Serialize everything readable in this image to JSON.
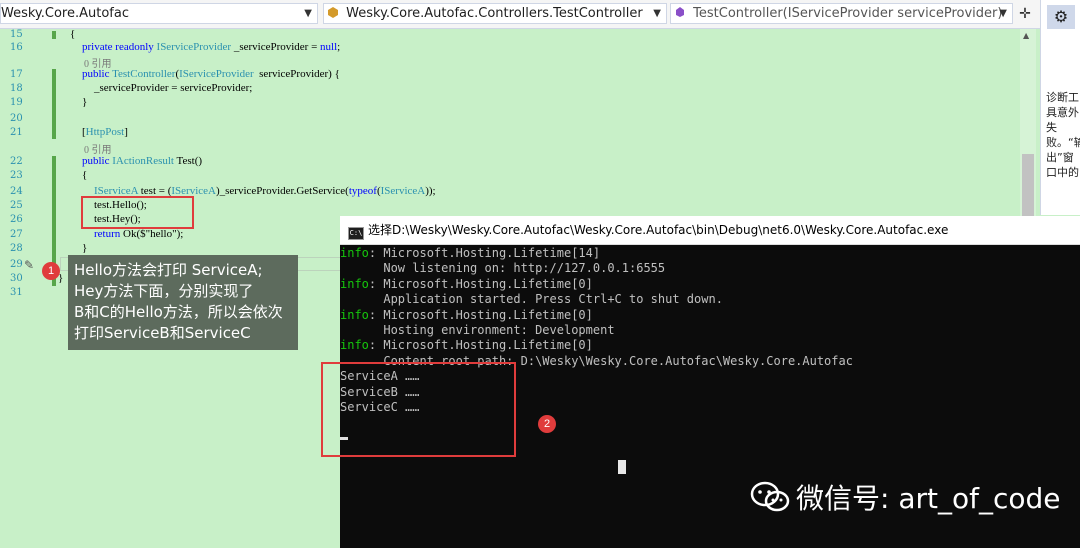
{
  "navbar": {
    "project": "Wesky.Core.Autofac",
    "class": "Wesky.Core.Autofac.Controllers.TestController",
    "member": "TestController(IServiceProvider serviceProvider)"
  },
  "side_panel": {
    "text": "诊断工具意外失败。“输出”窗口中的"
  },
  "editor": {
    "line_numbers": [
      "15",
      "16",
      "17",
      "18",
      "19",
      "20",
      "21",
      "22",
      "23",
      "24",
      "25",
      "26",
      "27",
      "28",
      "29",
      "30",
      "31"
    ],
    "ref_label": "0 引用",
    "tooltip_lines": [
      "Hello方法会打印 ServiceA;",
      "Hey方法下面，分别实现了",
      "B和C的Hello方法，所以会依次",
      "打印ServiceB和ServiceC"
    ]
  },
  "badges": {
    "one": "1",
    "two": "2"
  },
  "console": {
    "title": "选择D:\\Wesky\\Wesky.Core.Autofac\\Wesky.Core.Autofac\\bin\\Debug\\net6.0\\Wesky.Core.Autofac.exe",
    "info_label": "info",
    "lines": [
      "Microsoft.Hosting.Lifetime[14]",
      "Now listening on: http://127.0.0.1:6555",
      "Microsoft.Hosting.Lifetime[0]",
      "Application started. Press Ctrl+C to shut down.",
      "Microsoft.Hosting.Lifetime[0]",
      "Hosting environment: Development",
      "Microsoft.Hosting.Lifetime[0]",
      "Content root path: D:\\Wesky\\Wesky.Core.Autofac\\Wesky.Core.Autofac"
    ],
    "output": [
      "ServiceA ……",
      "ServiceB ……",
      "ServiceC ……"
    ]
  },
  "watermark": {
    "text": "微信号: art_of_code"
  }
}
